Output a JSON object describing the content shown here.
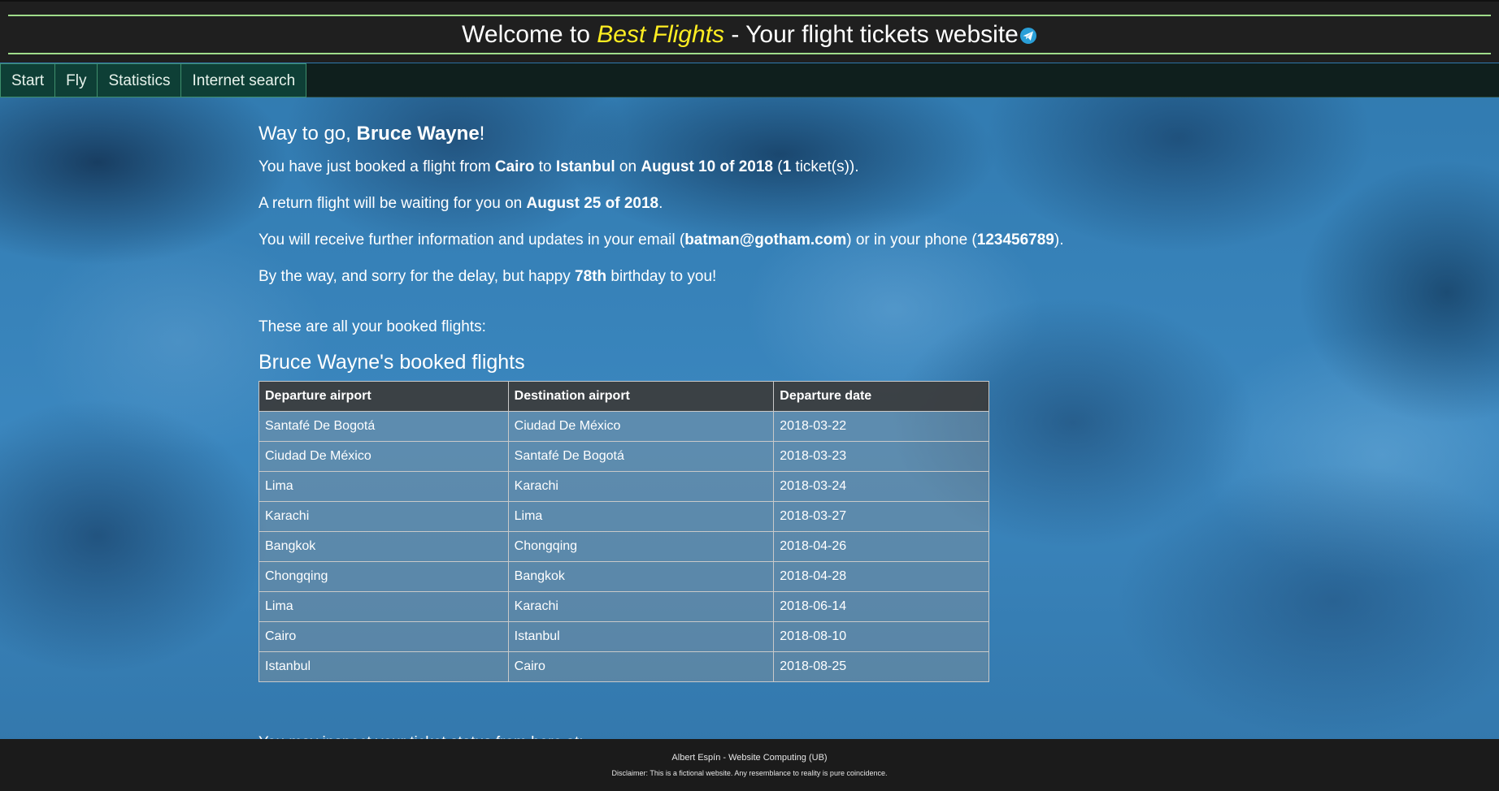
{
  "header": {
    "title_prefix": "Welcome to ",
    "brand": "Best Flights",
    "title_suffix": " - Your flight tickets website"
  },
  "nav": {
    "items": [
      "Start",
      "Fly",
      "Statistics",
      "Internet search"
    ]
  },
  "message": {
    "greeting_prefix": "Way to go, ",
    "user_name": "Bruce Wayne",
    "greeting_suffix": "!",
    "booking": {
      "t1": "You have just booked a flight from ",
      "origin": "Cairo",
      "t2": " to ",
      "destination": "Istanbul",
      "t3": " on ",
      "date": "August 10 of 2018",
      "t4": " (",
      "tickets": "1",
      "t5": " ticket(s))."
    },
    "return": {
      "t1": "A return flight will be waiting for you on ",
      "date": "August 25 of 2018",
      "t2": "."
    },
    "contact": {
      "t1": "You will receive further information and updates in your email (",
      "email": "batman@gotham.com",
      "t2": ") or in your phone (",
      "phone": "123456789",
      "t3": ")."
    },
    "birthday": {
      "t1": "By the way, and sorry for the delay, but happy ",
      "age": "78th",
      "t2": " birthday to you!"
    },
    "list_intro": "These are all your booked flights:"
  },
  "flights_table": {
    "title": "Bruce Wayne's booked flights",
    "headers": [
      "Departure airport",
      "Destination airport",
      "Departure date"
    ],
    "rows": [
      [
        "Santafé De Bogotá",
        "Ciudad De México",
        "2018-03-22"
      ],
      [
        "Ciudad De México",
        "Santafé De Bogotá",
        "2018-03-23"
      ],
      [
        "Lima",
        "Karachi",
        "2018-03-24"
      ],
      [
        "Karachi",
        "Lima",
        "2018-03-27"
      ],
      [
        "Bangkok",
        "Chongqing",
        "2018-04-26"
      ],
      [
        "Chongqing",
        "Bangkok",
        "2018-04-28"
      ],
      [
        "Lima",
        "Karachi",
        "2018-06-14"
      ],
      [
        "Cairo",
        "Istanbul",
        "2018-08-10"
      ],
      [
        "Istanbul",
        "Cairo",
        "2018-08-25"
      ]
    ]
  },
  "cut_off_text": "You may inspect your ticket status from here at:",
  "footer": {
    "credit": "Albert Espín - Website Computing (UB)",
    "disclaimer": "Disclaimer: This is a fictional website. Any resemblance to reality is pure coincidence."
  },
  "icons": {
    "header_icon": "paper-plane-icon"
  },
  "colors": {
    "brand": "#ffee22",
    "header_line": "#9fdc8a",
    "nav_bg": "#0e3f36",
    "nav_border": "#3f8f6d"
  }
}
